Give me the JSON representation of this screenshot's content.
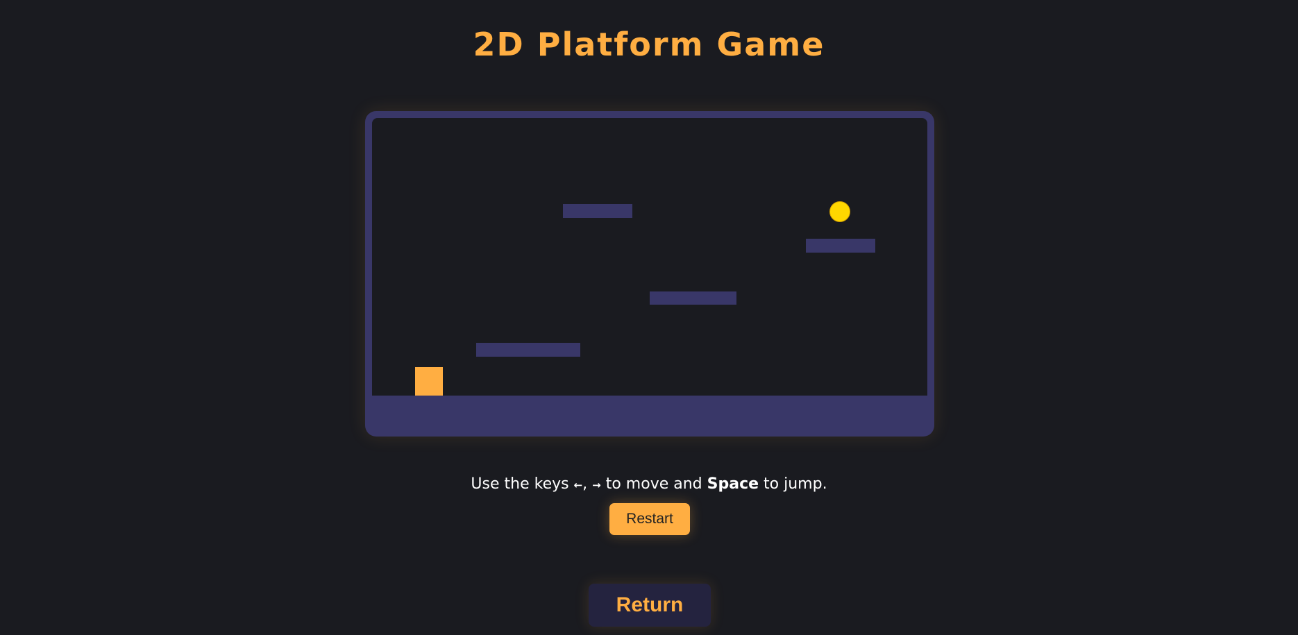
{
  "page": {
    "title": "2D Platform Game"
  },
  "game": {
    "platform_color": "#393768",
    "player_color": "#ffae42",
    "coin_color": "#ffd700",
    "background_color": "#1a1b20"
  },
  "instructions": {
    "prefix": "Use the keys ",
    "left_arrow": "←",
    "separator": ", ",
    "right_arrow": "→",
    "middle": " to move and ",
    "space_key": "Space",
    "suffix": " to jump."
  },
  "controls": {
    "restart_label": "Restart",
    "return_label": "Return"
  },
  "colors": {
    "accent": "#ffae42",
    "page_background": "#1a1b20",
    "frame": "#393768",
    "return_button_bg": "#24233f"
  }
}
